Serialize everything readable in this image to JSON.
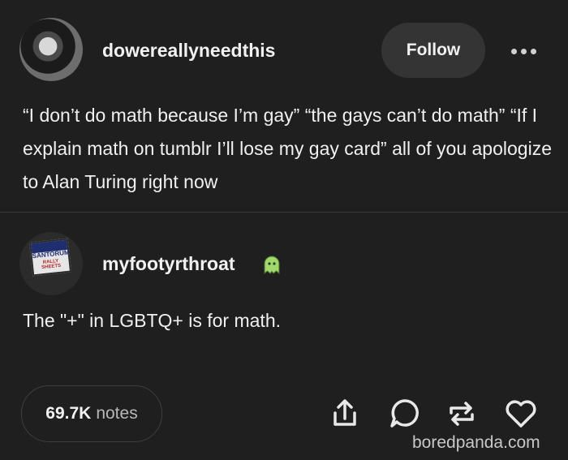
{
  "post": {
    "username": "dowereallyneedthis",
    "follow_label": "Follow",
    "text": "“I don’t do math because I’m gay” “the gays can’t do math” “If I explain math on tumblr I’ll lose my gay card” all of you apologize to Alan Turing right now"
  },
  "reblog": {
    "username": "myfootyrthroat",
    "text": "The \"+\" in LGBTQ+ is for math.",
    "avatar_sign_text": "SANTORUM",
    "avatar_sign_subtext": "RALLY SHEETS"
  },
  "footer": {
    "notes_count": "69.7K",
    "notes_label": "notes"
  },
  "watermark": "boredpanda.com",
  "icons": [
    "more-icon",
    "ghost-badge-icon",
    "share-icon",
    "reply-icon",
    "reblog-icon",
    "like-icon"
  ],
  "colors": {
    "background": "#1f1f1f",
    "text": "#f0f0f0",
    "button": "#343434",
    "ghost": "#9fd86b"
  }
}
